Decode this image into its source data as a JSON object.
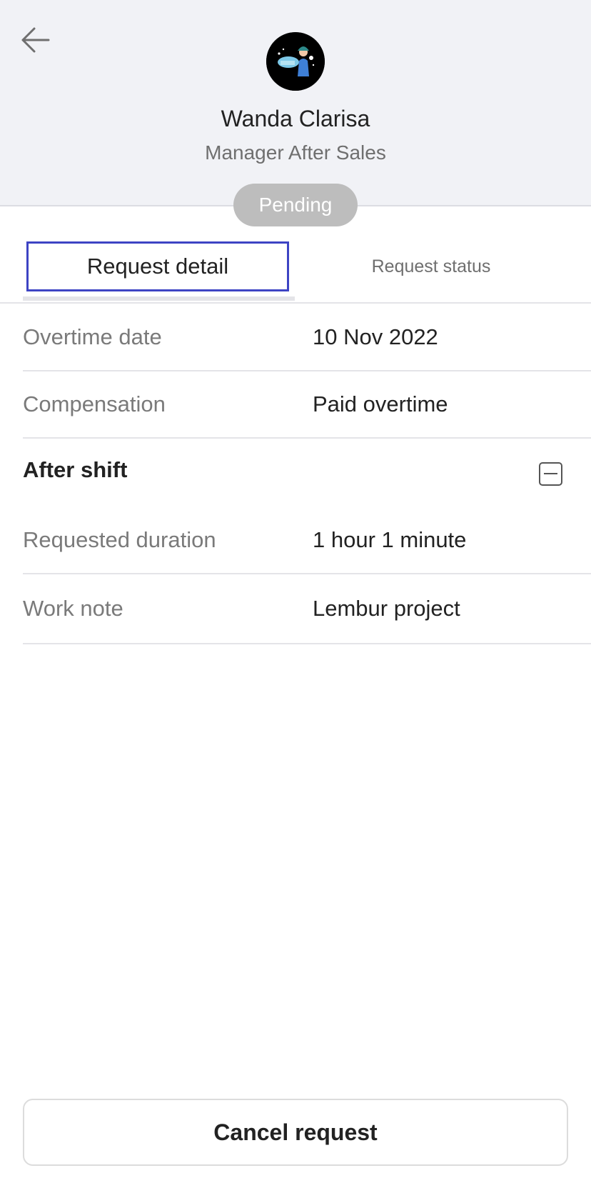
{
  "header": {
    "name": "Wanda Clarisa",
    "role": "Manager After Sales",
    "status": "Pending"
  },
  "tabs": {
    "detail": "Request detail",
    "status": "Request status"
  },
  "details": {
    "overtime_date": {
      "label": "Overtime date",
      "value": "10 Nov 2022"
    },
    "compensation": {
      "label": "Compensation",
      "value": "Paid overtime"
    }
  },
  "after_shift": {
    "title": "After shift",
    "requested_duration": {
      "label": "Requested duration",
      "value": "1 hour 1 minute"
    },
    "work_note": {
      "label": "Work note",
      "value": "Lembur project"
    }
  },
  "footer": {
    "cancel_label": "Cancel request"
  },
  "colors": {
    "accent": "#3d44c4",
    "header_bg": "#f1f2f6",
    "badge_bg": "#bdbdbd"
  }
}
